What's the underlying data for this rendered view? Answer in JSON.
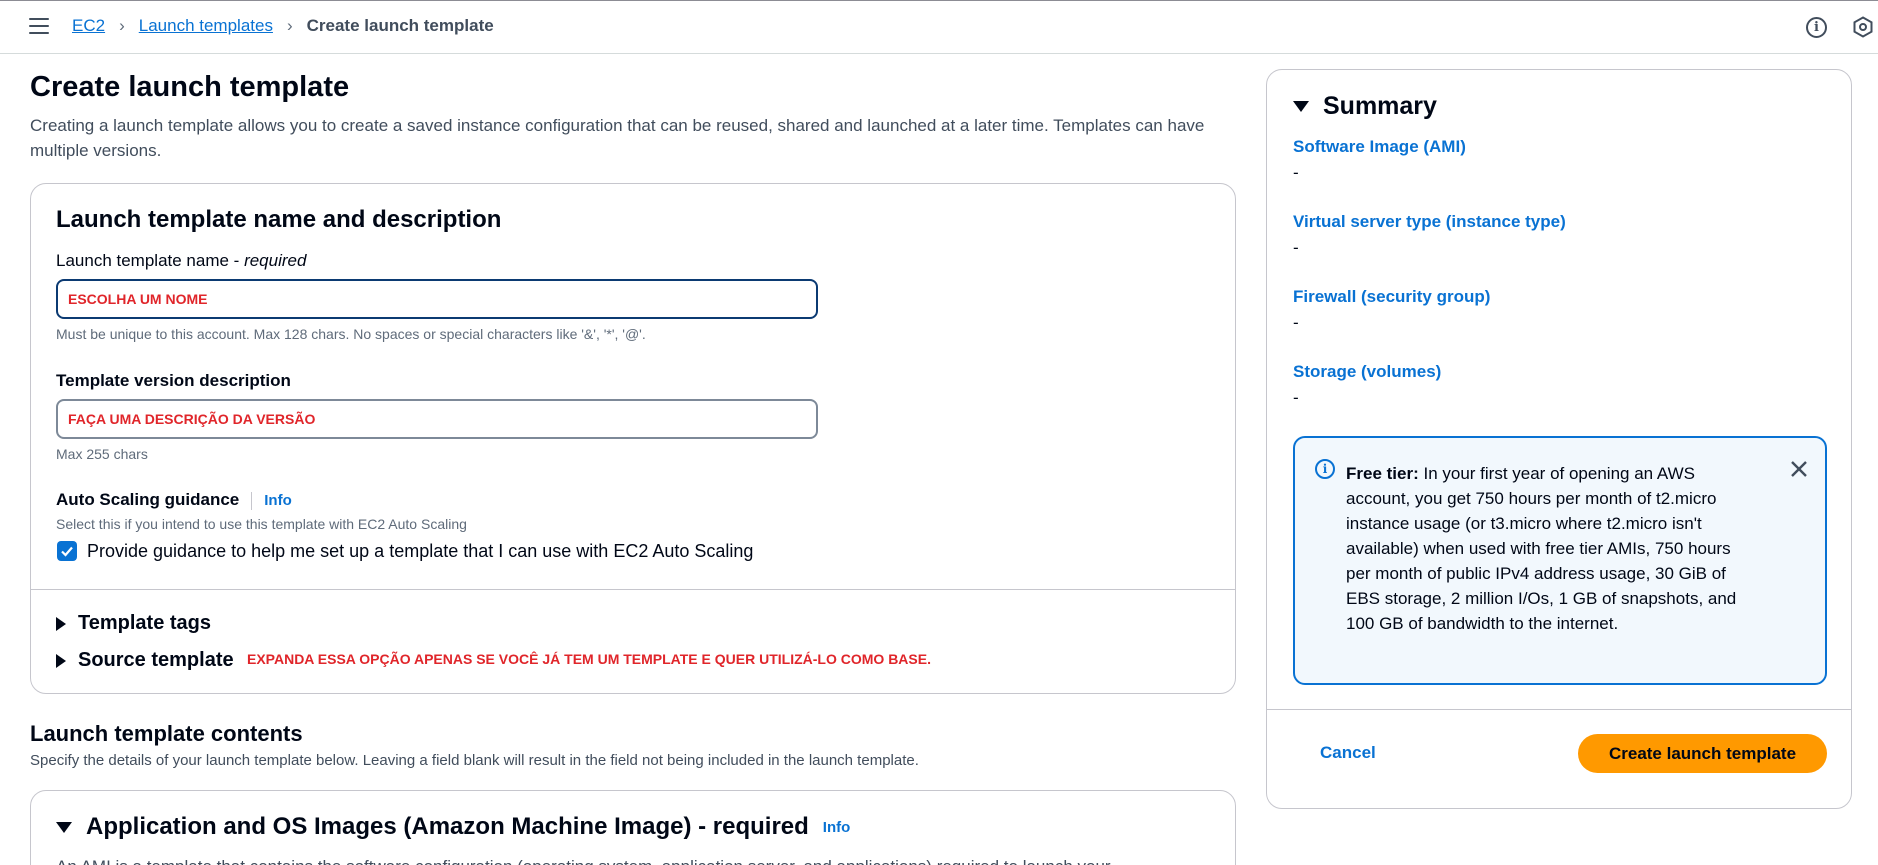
{
  "breadcrumb": {
    "items": [
      "EC2",
      "Launch templates"
    ],
    "current": "Create launch template"
  },
  "page": {
    "title": "Create launch template",
    "description": "Creating a launch template allows you to create a saved instance configuration that can be reused, shared and launched at a later time. Templates can have multiple versions."
  },
  "name_section": {
    "title": "Launch template name and description",
    "name_label": "Launch template name - ",
    "name_required": "required",
    "name_value": "ESCOLHA UM NOME",
    "name_hint": "Must be unique to this account. Max 128 chars. No spaces or special characters like '&', '*', '@'.",
    "version_label": "Template version description",
    "version_value": "FAÇA UMA DESCRIÇÃO DA VERSÃO",
    "version_hint": "Max 255 chars",
    "autoscaling_label": "Auto Scaling guidance",
    "info": "Info",
    "autoscaling_hint": "Select this if you intend to use this template with EC2 Auto Scaling",
    "autoscaling_checkbox": "Provide guidance to help me set up a template that I can use with EC2 Auto Scaling",
    "autoscaling_checked": true,
    "template_tags": "Template tags",
    "source_template": "Source template",
    "source_note": "EXPANDA ESSA OPÇÃO APENAS SE VOCÊ JÁ TEM UM TEMPLATE E QUER UTILIZÁ-LO COMO BASE."
  },
  "contents": {
    "title": "Launch template contents",
    "description": "Specify the details of your launch template below. Leaving a field blank will result in the field not being included in the launch template.",
    "ami_title": "Application and OS Images (Amazon Machine Image) - required",
    "info": "Info",
    "ami_desc": "An AMI is a template that contains the software configuration (operating system, application server, and applications) required to launch your"
  },
  "summary": {
    "title": "Summary",
    "items": [
      {
        "label": "Software Image (AMI)",
        "value": "-"
      },
      {
        "label": "Virtual server type (instance type)",
        "value": "-"
      },
      {
        "label": "Firewall (security group)",
        "value": "-"
      },
      {
        "label": "Storage (volumes)",
        "value": "-"
      }
    ],
    "free_tier_label": "Free tier:",
    "free_tier_text": " In your first year of opening an AWS account, you get 750 hours per month of t2.micro instance usage (or t3.micro where t2.micro isn't available) when used with free tier AMIs, 750 hours per month of public IPv4 address usage, 30 GiB of EBS storage, 2 million I/Os, 1 GB of snapshots, and 100 GB of bandwidth to the internet.",
    "cancel": "Cancel",
    "create": "Create launch template"
  },
  "colors": {
    "accent": "#0972d3",
    "primary_button": "#ff9900",
    "annotation_red": "#e0252a"
  }
}
